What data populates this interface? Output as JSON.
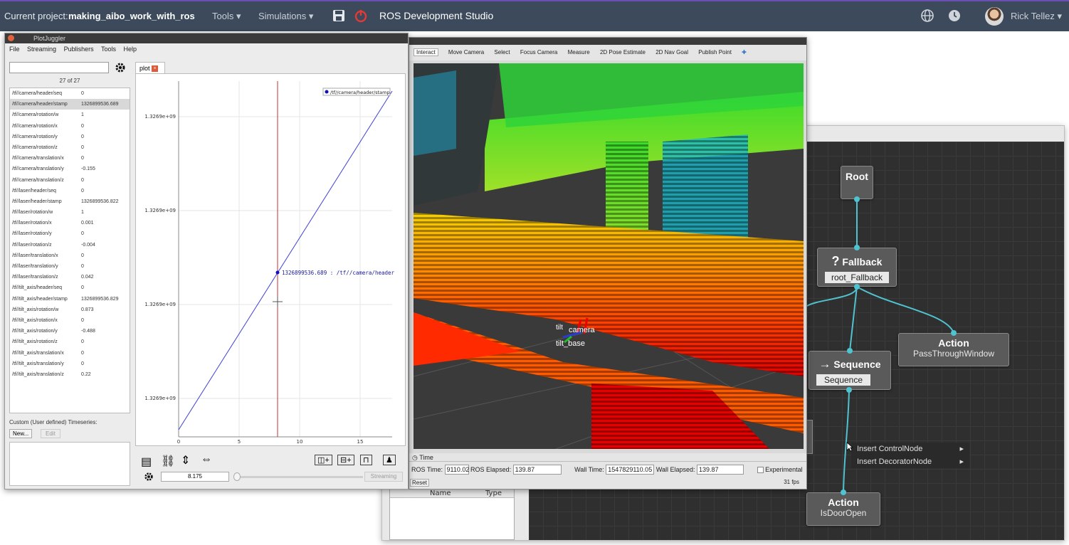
{
  "topbar": {
    "project_label": "Current project:",
    "project_name": "making_aibo_work_with_ros",
    "tools_menu": "Tools",
    "simulations_menu": "Simulations",
    "studio_title": "ROS Development Studio",
    "user_name": "Rick Tellez",
    "icons": [
      "save-icon",
      "power-icon",
      "globe-icon",
      "clock-icon",
      "avatar"
    ]
  },
  "plotjuggler": {
    "title": "PlotJuggler",
    "menu": [
      "File",
      "Streaming",
      "Publishers",
      "Tools",
      "Help"
    ],
    "count": "27 of 27",
    "tab": "plot",
    "rows": [
      {
        "name": "/tf//camera/header/seq",
        "value": "0"
      },
      {
        "name": "/tf//camera/header/stamp",
        "value": "1326899536.689"
      },
      {
        "name": "/tf//camera/rotation/w",
        "value": "1"
      },
      {
        "name": "/tf//camera/rotation/x",
        "value": "0"
      },
      {
        "name": "/tf//camera/rotation/y",
        "value": "0"
      },
      {
        "name": "/tf//camera/rotation/z",
        "value": "0"
      },
      {
        "name": "/tf//camera/translation/x",
        "value": "0"
      },
      {
        "name": "/tf//camera/translation/y",
        "value": "-0.155"
      },
      {
        "name": "/tf//camera/translation/z",
        "value": "0"
      },
      {
        "name": "/tf//laser/header/seq",
        "value": "0"
      },
      {
        "name": "/tf//laser/header/stamp",
        "value": "1326899536.822"
      },
      {
        "name": "/tf//laser/rotation/w",
        "value": "1"
      },
      {
        "name": "/tf//laser/rotation/x",
        "value": "0.001"
      },
      {
        "name": "/tf//laser/rotation/y",
        "value": "0"
      },
      {
        "name": "/tf//laser/rotation/z",
        "value": "-0.004"
      },
      {
        "name": "/tf//laser/translation/x",
        "value": "0"
      },
      {
        "name": "/tf//laser/translation/y",
        "value": "0"
      },
      {
        "name": "/tf//laser/translation/z",
        "value": "0.042"
      },
      {
        "name": "/tf//tilt_axis/header/seq",
        "value": "0"
      },
      {
        "name": "/tf//tilt_axis/header/stamp",
        "value": "1326899536.829"
      },
      {
        "name": "/tf//tilt_axis/rotation/w",
        "value": "0.873"
      },
      {
        "name": "/tf//tilt_axis/rotation/x",
        "value": "0"
      },
      {
        "name": "/tf//tilt_axis/rotation/y",
        "value": "-0.488"
      },
      {
        "name": "/tf//tilt_axis/rotation/z",
        "value": "0"
      },
      {
        "name": "/tf//tilt_axis/translation/x",
        "value": "0"
      },
      {
        "name": "/tf//tilt_axis/translation/y",
        "value": "0"
      },
      {
        "name": "/tf//tilt_axis/translation/z",
        "value": "0.22"
      }
    ],
    "custom_label": "Custom (User defined) Timeseries:",
    "new_button": "New...",
    "edit_button": "Edit",
    "legend": "/tf//camera/header/stamp",
    "y_ticks": [
      "1.3269e+09",
      "1.3269e+09",
      "1.3269e+09",
      "1.3269e+09"
    ],
    "x_ticks": [
      "0",
      "5",
      "10",
      "15"
    ],
    "tracker_label": "1326899536.689 : /tf//camera/header",
    "time_value": "8.175",
    "streaming_button": "Streaming"
  },
  "rviz": {
    "tools": [
      "Interact",
      "Move Camera",
      "Select",
      "Focus Camera",
      "Measure",
      "2D Pose Estimate",
      "2D Nav Goal",
      "Publish Point"
    ],
    "frame_labels": [
      "tilt",
      "camera",
      "tilt_base"
    ],
    "time_panel_title": "Time",
    "ros_time_label": "ROS Time:",
    "ros_time": "9110.02",
    "ros_elapsed_label": "ROS Elapsed:",
    "ros_elapsed": "139.87",
    "wall_time_label": "Wall Time:",
    "wall_time": "1547829110.05",
    "wall_elapsed_label": "Wall Elapsed:",
    "wall_elapsed": "139.87",
    "experimental": "Experimental",
    "reset_button": "Reset",
    "fps": "31 fps"
  },
  "groot": {
    "left_headers": [
      "Name",
      "Type"
    ],
    "nodes": {
      "root": {
        "title": "Root"
      },
      "fallback": {
        "title": "Fallback",
        "symbol": "?",
        "label": "root_Fallback"
      },
      "action_pass": {
        "title": "Action",
        "sub": "PassThroughWindow"
      },
      "sequence": {
        "title": "Sequence",
        "symbol": "→",
        "label": "Sequence"
      },
      "action_door": {
        "title": "Action",
        "sub": "IsDoorOpen"
      }
    },
    "context_menu": [
      "Insert ControlNode",
      "Insert DecoratorNode"
    ]
  }
}
